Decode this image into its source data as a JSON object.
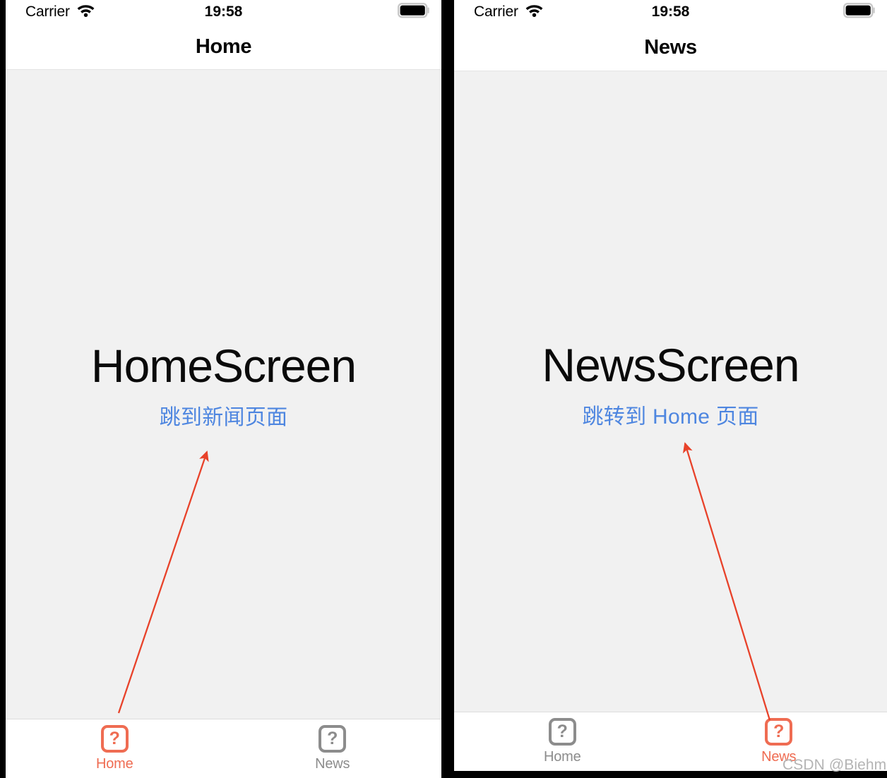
{
  "colors": {
    "divider": "#000000",
    "screen_bg": "#f1f1f1",
    "bar_bg": "#ffffff",
    "link_blue": "#4e86e0",
    "accent_orange": "#ef6c52",
    "inactive_gray": "#8c8c8c",
    "annotation_red": "#e8422a",
    "watermark_gray": "#b4b4b4"
  },
  "panels": [
    {
      "id": "home-screen",
      "status_bar": {
        "carrier": "Carrier",
        "wifi_icon": "wifi-icon",
        "time": "19:58",
        "battery_icon": "battery-full-icon"
      },
      "nav_bar": {
        "title": "Home"
      },
      "content": {
        "heading": "HomeScreen",
        "link_label": "跳到新闻页面"
      },
      "tab_bar": {
        "items": [
          {
            "label": "Home",
            "icon": "image-placeholder-question-icon",
            "glyph": "?",
            "active": true
          },
          {
            "label": "News",
            "icon": "image-placeholder-question-icon",
            "glyph": "?",
            "active": false
          }
        ]
      },
      "annotation": {
        "label": "red-arrow-pointing-to-link"
      }
    },
    {
      "id": "news-screen",
      "status_bar": {
        "carrier": "Carrier",
        "wifi_icon": "wifi-icon",
        "time": "19:58",
        "battery_icon": "battery-full-icon"
      },
      "nav_bar": {
        "title": "News"
      },
      "content": {
        "heading": "NewsScreen",
        "link_label": "跳转到 Home 页面"
      },
      "tab_bar": {
        "items": [
          {
            "label": "Home",
            "icon": "image-placeholder-question-icon",
            "glyph": "?",
            "active": false
          },
          {
            "label": "News",
            "icon": "image-placeholder-question-icon",
            "glyph": "?",
            "active": true
          }
        ]
      },
      "annotation": {
        "label": "red-arrow-from-news-tab-to-link"
      }
    }
  ],
  "watermark": {
    "text": "CSDN @Biehmltym"
  }
}
